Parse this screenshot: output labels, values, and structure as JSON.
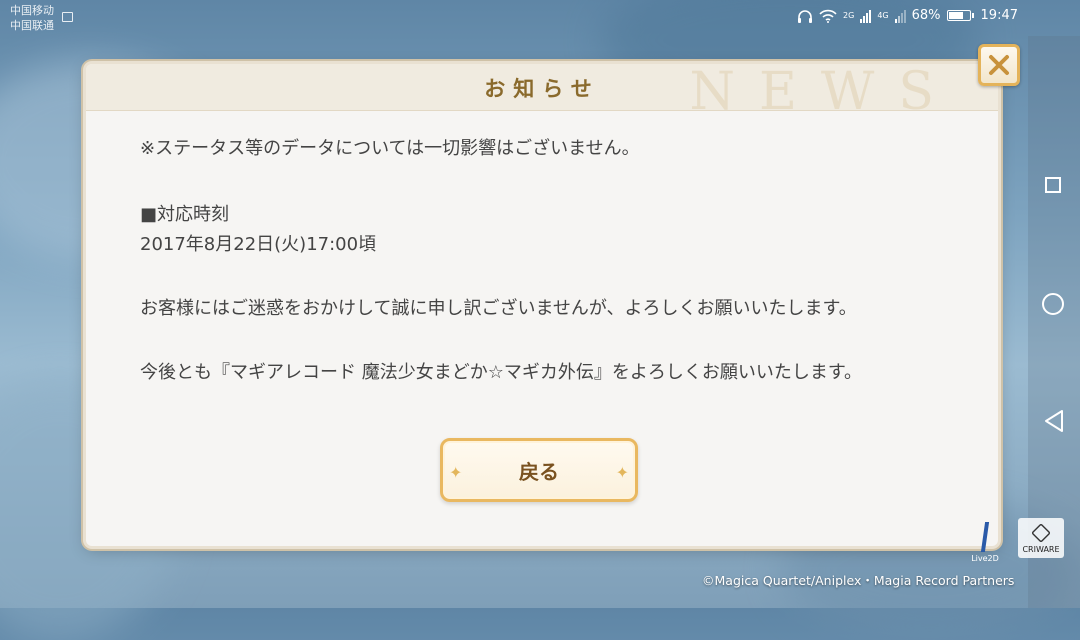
{
  "status_bar": {
    "carrier_1": "中国移动",
    "carrier_2": "中国联通",
    "net_2g": "2G",
    "net_4g": "4G",
    "battery": "68%",
    "battery_level": 0.68,
    "time": "19:47"
  },
  "dialog": {
    "title": "お知らせ",
    "watermark": "NEWS",
    "lines": [
      "※ステータス等のデータについては一切影響はございません。",
      "■対応時刻",
      "2017年8月22日(火)17:00頃",
      "お客様にはご迷惑をおかけして誠に申し訳ございませんが、よろしくお願いいたします。",
      "今後とも『マギアレコード 魔法少女まどか☆マギカ外伝』をよろしくお願いいたします。"
    ],
    "back_label": "戻る"
  },
  "footer": {
    "live2d": "Live2D",
    "criware": "CRIWARE",
    "copyright": "©Magica Quartet/Aniplex・Magia Record Partners"
  },
  "icons": [
    "headphone-icon",
    "wifi-icon",
    "signal-icon",
    "battery-icon",
    "close-icon",
    "nav-square-icon",
    "nav-home-icon",
    "nav-back-icon"
  ]
}
